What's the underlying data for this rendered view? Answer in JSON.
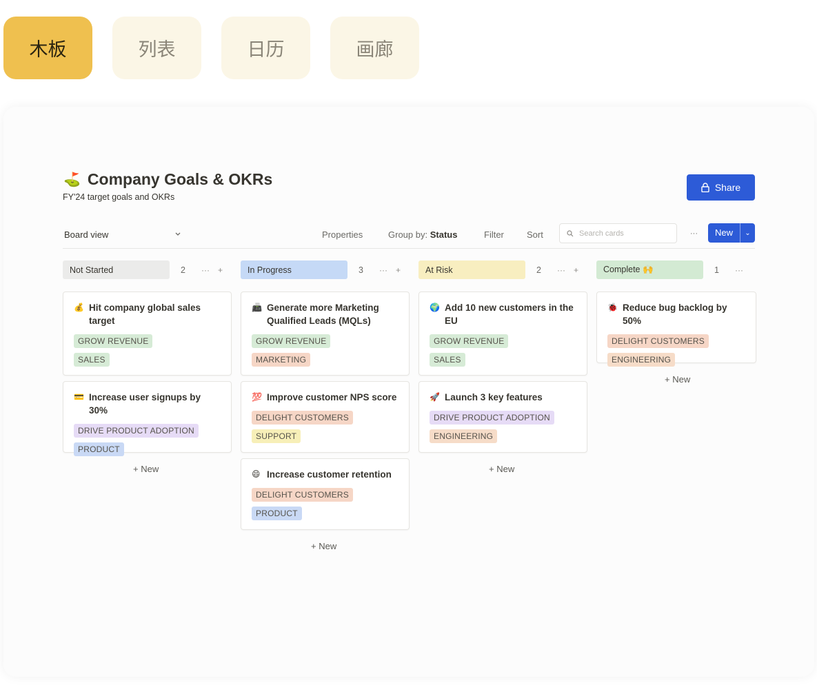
{
  "tabs": [
    {
      "label": "木板",
      "active": true
    },
    {
      "label": "列表",
      "active": false
    },
    {
      "label": "日历",
      "active": false
    },
    {
      "label": "画廊",
      "active": false
    }
  ],
  "page": {
    "icon": "⛳",
    "title": "Company Goals & OKRs",
    "subtitle": "FY'24 target goals and OKRs",
    "share_label": "Share"
  },
  "toolbar": {
    "view_label": "Board view",
    "properties": "Properties",
    "group_by_prefix": "Group by:",
    "group_by_value": "Status",
    "filter": "Filter",
    "sort": "Sort",
    "search_placeholder": "Search cards",
    "more": "···",
    "new_label": "New"
  },
  "colors": {
    "accent": "#2d5bd7",
    "tab_active": "#efc04f",
    "tab_inactive": "#fbf6e6",
    "grow_revenue": "#d3ead3",
    "sales": "#d3ead3",
    "marketing": "#f6d5c4",
    "delight": "#f6d5c4",
    "engineering": "#f6ddc8",
    "drive_adoption": "#e5d9f5",
    "product": "#c8d8f4",
    "support": "#f7efb8"
  },
  "add_new_label": "+ New",
  "columns": [
    {
      "name": "Not Started",
      "count": "2",
      "color": "#ebebea",
      "cards": [
        {
          "emoji": "💰",
          "title": "Hit company global sales target",
          "tags": [
            {
              "label": "GROW REVENUE",
              "color": "#d6ebd6"
            },
            {
              "label": "SALES",
              "color": "#d6ebd6"
            }
          ]
        },
        {
          "emoji": "💳",
          "title": "Increase user signups by 30%",
          "tags": [
            {
              "label": "DRIVE PRODUCT ADOPTION",
              "color": "#e6dbf6"
            },
            {
              "label": "PRODUCT",
              "color": "#c9d9f5"
            }
          ]
        }
      ]
    },
    {
      "name": "In Progress",
      "count": "3",
      "color": "#c5d9f6",
      "cards": [
        {
          "emoji": "📠",
          "title": "Generate more Marketing Qualified Leads (MQLs)",
          "tags": [
            {
              "label": "GROW REVENUE",
              "color": "#d6ebd6"
            },
            {
              "label": "MARKETING",
              "color": "#f6d6c6"
            }
          ]
        },
        {
          "emoji": "💯",
          "title": "Improve customer NPS score",
          "tags": [
            {
              "label": "DELIGHT CUSTOMERS",
              "color": "#f6d6c6"
            },
            {
              "label": "SUPPORT",
              "color": "#f7efb8"
            }
          ]
        },
        {
          "emoji": "😄",
          "title": "Increase customer retention",
          "tags": [
            {
              "label": "DELIGHT CUSTOMERS",
              "color": "#f6d6c6"
            },
            {
              "label": "PRODUCT",
              "color": "#c9d9f5"
            }
          ]
        }
      ]
    },
    {
      "name": "At Risk",
      "count": "2",
      "color": "#f8eec0",
      "cards": [
        {
          "emoji": "🌍",
          "title": "Add 10 new customers in the EU",
          "tags": [
            {
              "label": "GROW REVENUE",
              "color": "#d6ebd6"
            },
            {
              "label": "SALES",
              "color": "#d6ebd6"
            }
          ]
        },
        {
          "emoji": "🚀",
          "title": "Launch 3 key features",
          "tags": [
            {
              "label": "DRIVE PRODUCT ADOPTION",
              "color": "#e6dbf6"
            },
            {
              "label": "ENGINEERING",
              "color": "#f6dcc8"
            }
          ]
        }
      ]
    },
    {
      "name": "Complete 🙌",
      "count": "1",
      "color": "#d3ead3",
      "cards": [
        {
          "emoji": "🐞",
          "title": "Reduce bug backlog by 50%",
          "tags": [
            {
              "label": "DELIGHT CUSTOMERS",
              "color": "#f6d6c6"
            },
            {
              "label": "ENGINEERING",
              "color": "#f6dcc8"
            }
          ]
        }
      ]
    }
  ]
}
